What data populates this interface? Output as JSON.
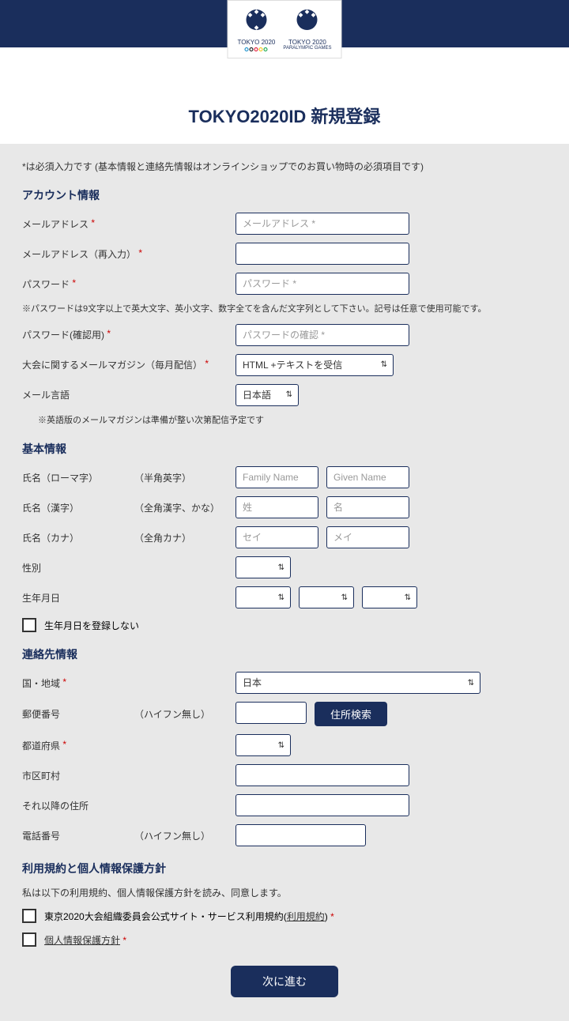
{
  "logo": {
    "olympic": "TOKYO 2020",
    "paralympic": "TOKYO 2020",
    "paralympic_sub": "PARALYMPIC GAMES"
  },
  "title": "TOKYO2020ID 新規登録",
  "required_note": "*は必須入力です (基本情報と連絡先情報はオンラインショップでのお買い物時の必須項目です)",
  "sections": {
    "account": "アカウント情報",
    "basic": "基本情報",
    "contact": "連絡先情報",
    "terms": "利用規約と個人情報保護方針"
  },
  "labels": {
    "email": "メールアドレス",
    "email_confirm": "メールアドレス（再入力）",
    "password": "パスワード",
    "password_confirm": "パスワード(確認用)",
    "mailmag": "大会に関するメールマガジン（毎月配信）",
    "mail_lang": "メール言語",
    "name_roman": "氏名（ローマ字）",
    "name_kanji": "氏名（漢字）",
    "name_kana": "氏名（カナ）",
    "roman_sub": "（半角英字）",
    "kanji_sub": "（全角漢字、かな）",
    "kana_sub": "（全角カナ）",
    "gender": "性別",
    "birthdate": "生年月日",
    "birthdate_skip": "生年月日を登録しない",
    "country": "国・地域",
    "postal": "郵便番号",
    "hyphen_none": "（ハイフン無し）",
    "prefecture": "都道府県",
    "city": "市区町村",
    "address_rest": "それ以降の住所",
    "phone": "電話番号"
  },
  "placeholders": {
    "email": "メールアドレス *",
    "password": "パスワード *",
    "password_confirm": "パスワードの確認 *",
    "family_name": "Family Name",
    "given_name": "Given Name",
    "sei_kanji": "姓",
    "mei_kanji": "名",
    "sei_kana": "セイ",
    "mei_kana": "メイ"
  },
  "selects": {
    "mailmag": "HTML +テキストを受信",
    "mail_lang": "日本語",
    "country": "日本"
  },
  "helpers": {
    "password": "※パスワードは9文字以上で英大文字、英小文字、数字全てを含んだ文字列として下さい。記号は任意で使用可能です。",
    "mail_lang": "※英語版のメールマガジンは準備が整い次第配信予定です"
  },
  "buttons": {
    "address_search": "住所検索",
    "submit": "次に進む"
  },
  "terms": {
    "desc": "私は以下の利用規約、個人情報保護方針を読み、同意します。",
    "tos_prefix": "東京2020大会組織委員会公式サイト・サービス利用規約(",
    "tos_link": "利用規約",
    "tos_suffix": ")",
    "privacy": "個人情報保護方針"
  },
  "req": "*"
}
